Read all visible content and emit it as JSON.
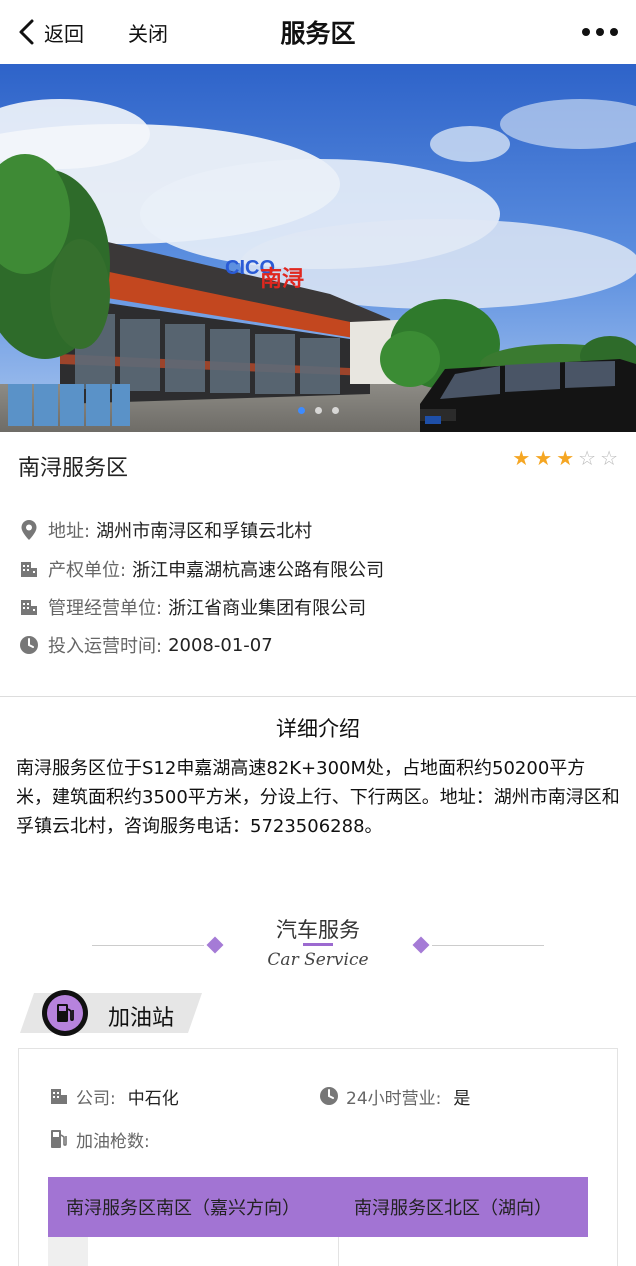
{
  "nav": {
    "back_label": "返回",
    "close_label": "关闭",
    "title": "服务区"
  },
  "hero": {
    "sign_brand": "CICO",
    "sign_name": "南浔",
    "slide_count": 3,
    "active_slide": 1
  },
  "station": {
    "name": "南浔服务区",
    "rating": 3,
    "rating_max": 5,
    "info": [
      {
        "label": "地址:",
        "value": "湖州市南浔区和孚镇云北村",
        "icon": "location-icon"
      },
      {
        "label": "产权单位:",
        "value": "浙江申嘉湖杭高速公路有限公司",
        "icon": "building-icon"
      },
      {
        "label": "管理经营单位:",
        "value": "浙江省商业集团有限公司",
        "icon": "building-icon"
      },
      {
        "label": "投入运营时间:",
        "value": "2008-01-07",
        "icon": "clock-icon"
      }
    ]
  },
  "detail": {
    "title": "详细介绍",
    "text": "南浔服务区位于S12申嘉湖高速82K+300M处，占地面积约50200平方米，建筑面积约3500平方米，分设上行、下行两区。地址：湖州市南浔区和孚镇云北村，咨询服务电话：5723506288。"
  },
  "car_service": {
    "title": "汽车服务",
    "subtitle": "Car Service",
    "accent_color": "#9c6ad0"
  },
  "gas_station": {
    "label": "加油站",
    "company_label": "公司:",
    "company_value": "中石化",
    "hours_label": "24小时营业:",
    "hours_value": "是",
    "nozzles_label": "加油枪数:",
    "table_headers": [
      "南浔服务区南区（嘉兴方向）",
      "南浔服务区北区（湖向）"
    ]
  }
}
